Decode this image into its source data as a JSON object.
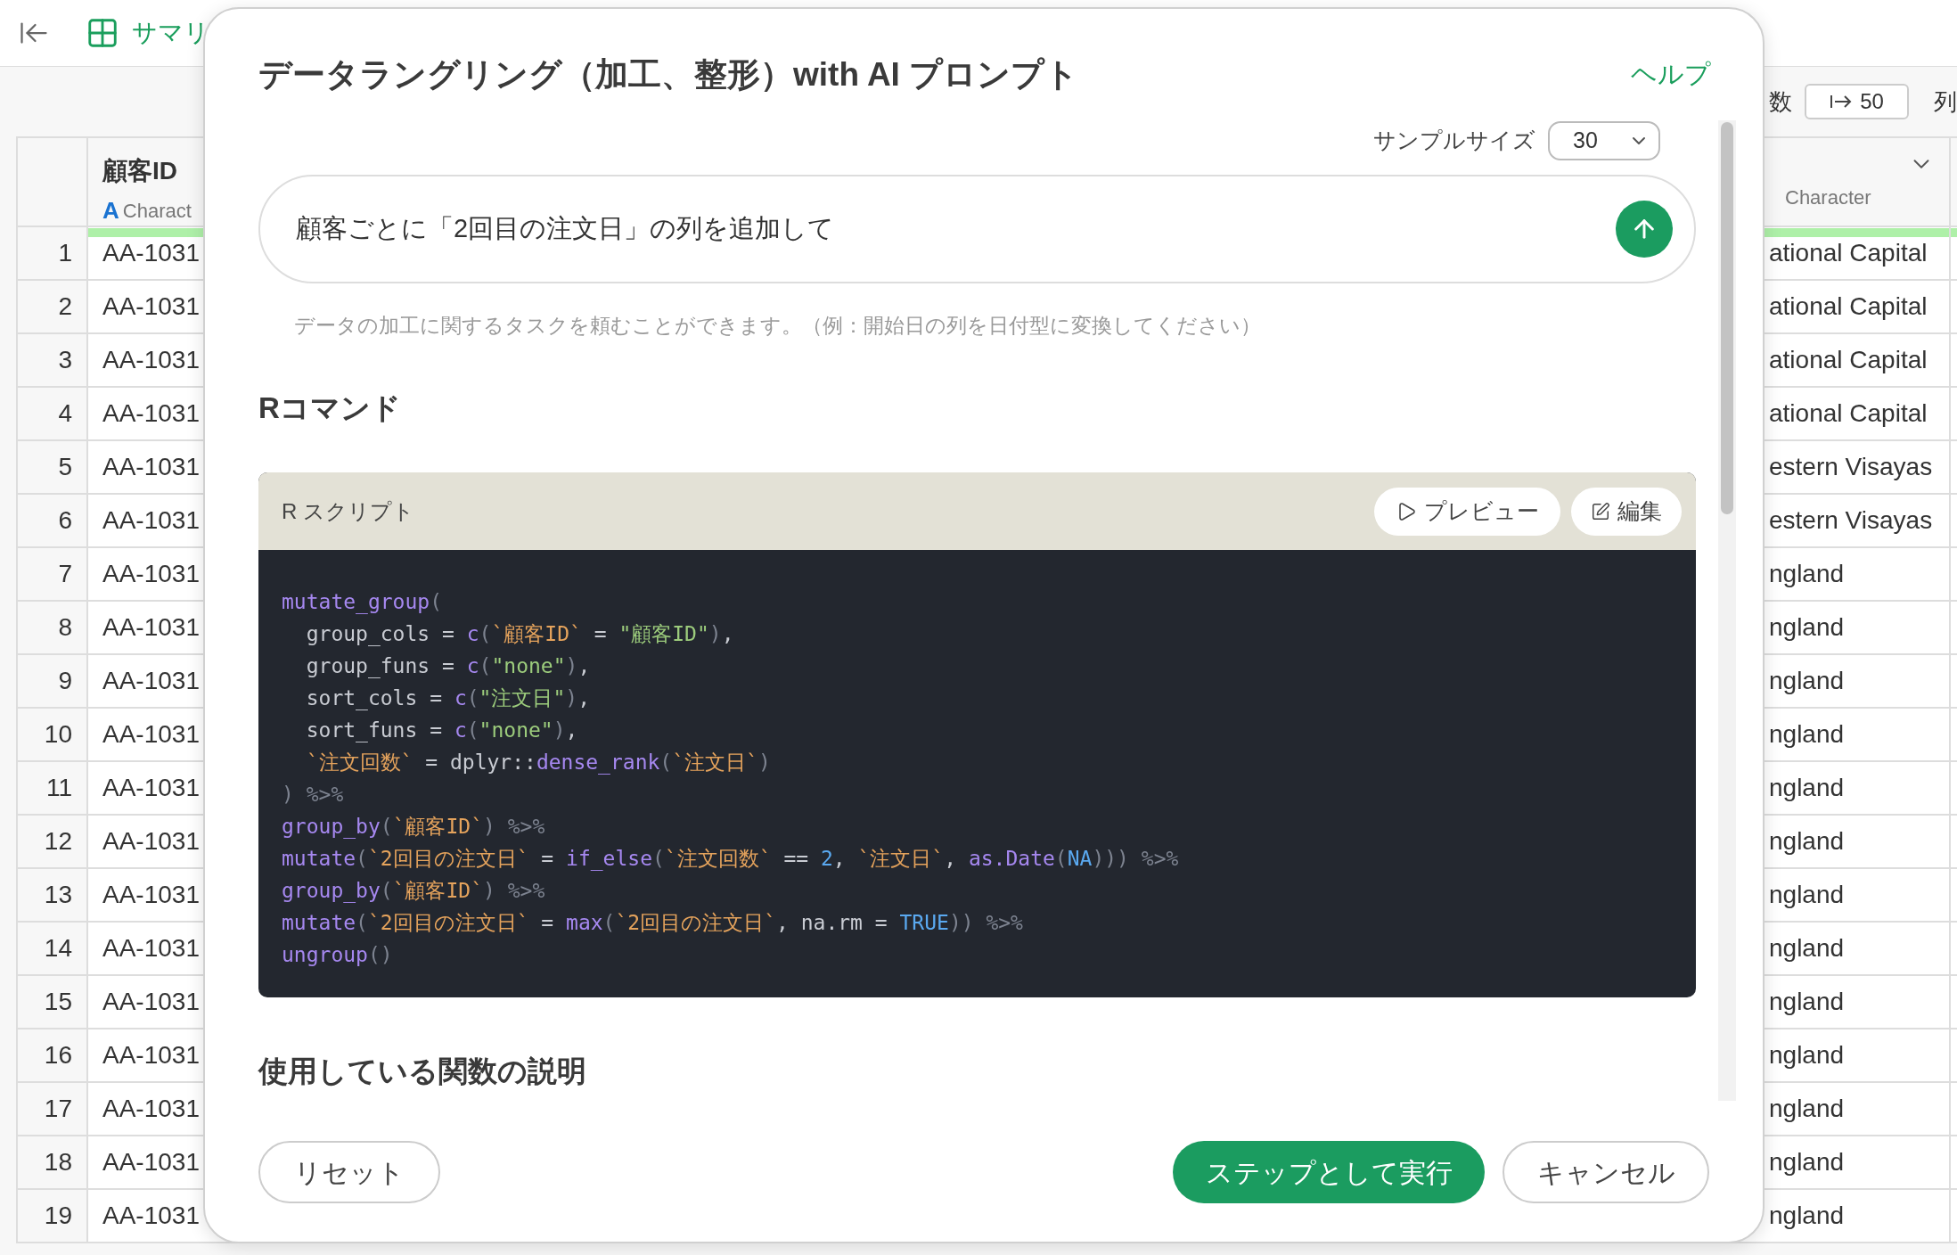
{
  "topbar": {
    "tab_label": "サマリ"
  },
  "toolbar": {
    "row_label": "数",
    "row_count": "50",
    "col_label": "列"
  },
  "table": {
    "columns": [
      {
        "name": "顧客ID",
        "type_badge": "A",
        "type": "Charact"
      },
      {
        "type": "Character"
      }
    ],
    "rows": [
      {
        "number": "1",
        "cells": [
          "AA-1031",
          "ational Capital"
        ]
      },
      {
        "number": "2",
        "cells": [
          "AA-1031",
          "ational Capital"
        ]
      },
      {
        "number": "3",
        "cells": [
          "AA-1031",
          "ational Capital"
        ]
      },
      {
        "number": "4",
        "cells": [
          "AA-1031",
          "ational Capital"
        ]
      },
      {
        "number": "5",
        "cells": [
          "AA-1031",
          "estern Visayas"
        ]
      },
      {
        "number": "6",
        "cells": [
          "AA-1031",
          "estern Visayas"
        ]
      },
      {
        "number": "7",
        "cells": [
          "AA-1031",
          "ngland"
        ]
      },
      {
        "number": "8",
        "cells": [
          "AA-1031",
          "ngland"
        ]
      },
      {
        "number": "9",
        "cells": [
          "AA-1031",
          "ngland"
        ]
      },
      {
        "number": "10",
        "cells": [
          "AA-1031",
          "ngland"
        ]
      },
      {
        "number": "11",
        "cells": [
          "AA-1031",
          "ngland"
        ]
      },
      {
        "number": "12",
        "cells": [
          "AA-1031",
          "ngland"
        ]
      },
      {
        "number": "13",
        "cells": [
          "AA-1031",
          "ngland"
        ]
      },
      {
        "number": "14",
        "cells": [
          "AA-1031",
          "ngland"
        ]
      },
      {
        "number": "15",
        "cells": [
          "AA-1031",
          "ngland"
        ]
      },
      {
        "number": "16",
        "cells": [
          "AA-1031",
          "ngland"
        ]
      },
      {
        "number": "17",
        "cells": [
          "AA-1031",
          "ngland"
        ]
      },
      {
        "number": "18",
        "cells": [
          "AA-1031",
          "ngland"
        ]
      },
      {
        "number": "19",
        "cells": [
          "AA-1031",
          "ngland"
        ]
      }
    ]
  },
  "dialog": {
    "title": "データラングリング（加工、整形）with AI プロンプト",
    "help_link": "ヘルプ",
    "sample_size": {
      "label": "サンプルサイズ",
      "value": "30"
    },
    "prompt": {
      "value": "顧客ごとに「2回目の注文日」の列を追加して"
    },
    "hint": "データの加工に関するタスクを頼むことができます。（例：開始日の列を日付型に変換してください）",
    "command_heading": "Rコマンド",
    "script": {
      "title": "R スクリプト",
      "preview_button": "プレビュー",
      "edit_button": "編集",
      "lines": [
        [
          {
            "kind": "fn",
            "text": "mutate_group"
          },
          {
            "kind": "punct",
            "text": "("
          }
        ],
        [
          {
            "kind": "plain",
            "text": "  group_cols = "
          },
          {
            "kind": "fn",
            "text": "c"
          },
          {
            "kind": "punct",
            "text": "("
          },
          {
            "kind": "name",
            "text": "`顧客ID`"
          },
          {
            "kind": "plain",
            "text": " = "
          },
          {
            "kind": "str",
            "text": "\"顧客ID\""
          },
          {
            "kind": "punct",
            "text": ")"
          },
          {
            "kind": "plain",
            "text": ","
          }
        ],
        [
          {
            "kind": "plain",
            "text": "  group_funs = "
          },
          {
            "kind": "fn",
            "text": "c"
          },
          {
            "kind": "punct",
            "text": "("
          },
          {
            "kind": "str",
            "text": "\"none\""
          },
          {
            "kind": "punct",
            "text": ")"
          },
          {
            "kind": "plain",
            "text": ","
          }
        ],
        [
          {
            "kind": "plain",
            "text": "  sort_cols = "
          },
          {
            "kind": "fn",
            "text": "c"
          },
          {
            "kind": "punct",
            "text": "("
          },
          {
            "kind": "str",
            "text": "\"注文日\""
          },
          {
            "kind": "punct",
            "text": ")"
          },
          {
            "kind": "plain",
            "text": ","
          }
        ],
        [
          {
            "kind": "plain",
            "text": "  sort_funs = "
          },
          {
            "kind": "fn",
            "text": "c"
          },
          {
            "kind": "punct",
            "text": "("
          },
          {
            "kind": "str",
            "text": "\"none\""
          },
          {
            "kind": "punct",
            "text": ")"
          },
          {
            "kind": "plain",
            "text": ","
          }
        ],
        [
          {
            "kind": "name",
            "text": "  `注文回数`"
          },
          {
            "kind": "plain",
            "text": " = dplyr::"
          },
          {
            "kind": "fn",
            "text": "dense_rank"
          },
          {
            "kind": "punct",
            "text": "("
          },
          {
            "kind": "name",
            "text": "`注文日`"
          },
          {
            "kind": "punct",
            "text": ")"
          }
        ],
        [
          {
            "kind": "punct",
            "text": ") %>%"
          }
        ],
        [
          {
            "kind": "fn",
            "text": "group_by"
          },
          {
            "kind": "punct",
            "text": "("
          },
          {
            "kind": "name",
            "text": "`顧客ID`"
          },
          {
            "kind": "punct",
            "text": ") %>%"
          }
        ],
        [
          {
            "kind": "fn",
            "text": "mutate"
          },
          {
            "kind": "punct",
            "text": "("
          },
          {
            "kind": "name",
            "text": "`2回目の注文日`"
          },
          {
            "kind": "plain",
            "text": " = "
          },
          {
            "kind": "fn",
            "text": "if_else"
          },
          {
            "kind": "punct",
            "text": "("
          },
          {
            "kind": "name",
            "text": "`注文回数`"
          },
          {
            "kind": "plain",
            "text": " == "
          },
          {
            "kind": "num",
            "text": "2"
          },
          {
            "kind": "plain",
            "text": ", "
          },
          {
            "kind": "name",
            "text": "`注文日`"
          },
          {
            "kind": "plain",
            "text": ", "
          },
          {
            "kind": "fn",
            "text": "as.Date"
          },
          {
            "kind": "punct",
            "text": "("
          },
          {
            "kind": "num",
            "text": "NA"
          },
          {
            "kind": "punct",
            "text": "))) %>%"
          }
        ],
        [
          {
            "kind": "fn",
            "text": "group_by"
          },
          {
            "kind": "punct",
            "text": "("
          },
          {
            "kind": "name",
            "text": "`顧客ID`"
          },
          {
            "kind": "punct",
            "text": ") %>%"
          }
        ],
        [
          {
            "kind": "fn",
            "text": "mutate"
          },
          {
            "kind": "punct",
            "text": "("
          },
          {
            "kind": "name",
            "text": "`2回目の注文日`"
          },
          {
            "kind": "plain",
            "text": " = "
          },
          {
            "kind": "fn",
            "text": "max"
          },
          {
            "kind": "punct",
            "text": "("
          },
          {
            "kind": "name",
            "text": "`2回目の注文日`"
          },
          {
            "kind": "plain",
            "text": ", na.rm = "
          },
          {
            "kind": "num",
            "text": "TRUE"
          },
          {
            "kind": "punct",
            "text": ")) %>%"
          }
        ],
        [
          {
            "kind": "fn",
            "text": "ungroup"
          },
          {
            "kind": "punct",
            "text": "()"
          }
        ]
      ]
    },
    "functions_heading": "使用している関数の説明",
    "buttons": {
      "reset": "リセット",
      "run": "ステップとして実行",
      "cancel": "キャンセル"
    }
  }
}
